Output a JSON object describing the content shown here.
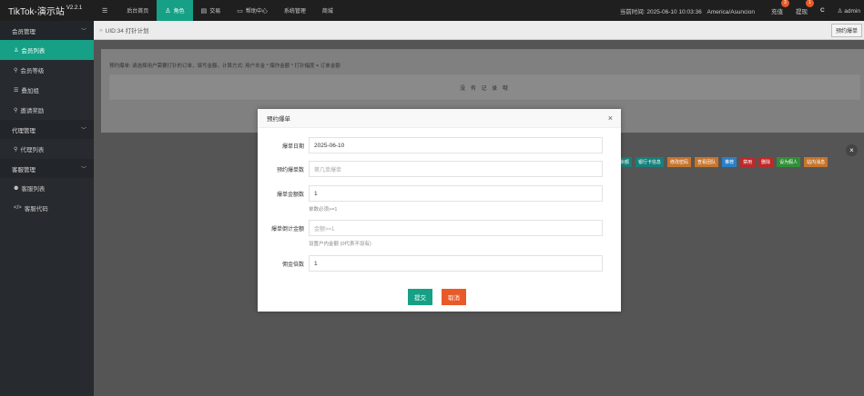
{
  "brand": {
    "title": "TikTok-演示站",
    "version": "V2.2.1"
  },
  "nav": [
    {
      "icon": "☰",
      "label": ""
    },
    {
      "icon": "",
      "label": "后台首页"
    },
    {
      "icon": "♙",
      "label": "角色"
    },
    {
      "icon": "▤",
      "label": "交易"
    },
    {
      "icon": "▭",
      "label": "帮助中心"
    },
    {
      "icon": "",
      "label": "系统管理"
    },
    {
      "icon": "",
      "label": "商城"
    }
  ],
  "topright": {
    "time_label": "当前时间:",
    "time_value": "2025-06-10 10:03:36",
    "timezone": "America/Asuncion",
    "recharge": "充值",
    "recharge_count": "3",
    "withdraw": "提现",
    "withdraw_count": "1",
    "refresh_icon": "C",
    "user": "admin"
  },
  "sidebar": {
    "groups": [
      {
        "label": "会员管理",
        "items": [
          {
            "icon": "♙",
            "label": "会员列表"
          },
          {
            "icon": "⚲",
            "label": "会员等级"
          },
          {
            "icon": "☰",
            "label": "叠加组"
          },
          {
            "icon": "⚲",
            "label": "邀请奖励"
          }
        ]
      },
      {
        "label": "代理管理",
        "items": [
          {
            "icon": "⚲",
            "label": "代理列表"
          }
        ]
      },
      {
        "label": "客服管理",
        "items": [
          {
            "icon": "⚉",
            "label": "客服列表"
          },
          {
            "icon": "</>",
            "label": "客服代码"
          }
        ]
      }
    ]
  },
  "breadcrumb": {
    "sep": "»",
    "text": "UID:34 打针计划",
    "button": "预约爆单"
  },
  "panel": {
    "tip": "预约爆单: 请选择用户需要打针的订单，填写金额。计算方式: 用户本金 * 爆炸金额 * 打针幅度 = 订单金额",
    "empty": "没 有 记 录 哦"
  },
  "actions": [
    {
      "label": "余额",
      "color": "#16807a"
    },
    {
      "label": "银行卡信息",
      "color": "#16807a"
    },
    {
      "label": "修改密码",
      "color": "#c7752c"
    },
    {
      "label": "查看团队",
      "color": "#c7752c"
    },
    {
      "label": "推荐",
      "color": "#2c7fc7"
    },
    {
      "label": "禁用",
      "color": "#c02828"
    },
    {
      "label": "删除",
      "color": "#c02828"
    },
    {
      "label": "设为假人",
      "color": "#2f8f36"
    },
    {
      "label": "站内消息",
      "color": "#c7752c"
    }
  ],
  "modal": {
    "title": "预约爆单",
    "fields": [
      {
        "label": "爆单日期",
        "value": "2025-06-10",
        "placeholder": "",
        "hint": ""
      },
      {
        "label": "预约爆单数",
        "value": "",
        "placeholder": "第几单爆单",
        "hint": ""
      },
      {
        "label": "爆单金额数",
        "value": "1",
        "placeholder": "",
        "hint": "单数必须>=1"
      },
      {
        "label": "爆单倒计金额",
        "value": "",
        "placeholder": "金额>=1",
        "hint": "设置户内金额 (0代表不设有)"
      },
      {
        "label": "佣金倍数",
        "value": "1",
        "placeholder": "",
        "hint": ""
      }
    ],
    "submit": "提交",
    "cancel": "取消"
  },
  "colors": {
    "accent": "#16a085",
    "danger": "#e85a28",
    "topbar": "#1f1f1f",
    "sidebar": "#272b2f"
  }
}
